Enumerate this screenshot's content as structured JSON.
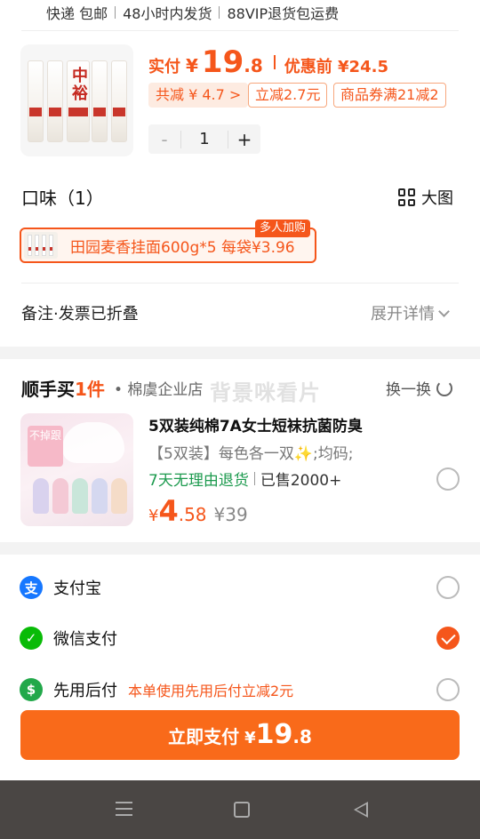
{
  "shipping": {
    "express": "快递 包邮",
    "dispatch": "48小时内发货",
    "vip": "88VIP退货包运费"
  },
  "product": {
    "thumb_brand": "中裕",
    "paid_label": "实付",
    "yen": "¥",
    "price_int": "19",
    "price_dec": ".8",
    "pre_discount": "优惠前 ¥24.5",
    "tags": [
      "共减 ¥ 4.7 >",
      "立减2.7元",
      "商品券满21减2"
    ],
    "stepper": {
      "minus": "-",
      "qty": "1",
      "plus": "+"
    }
  },
  "flavor": {
    "title": "口味（1）",
    "big_pic": "大图",
    "option_label": "田园麦香挂面600g*5  每袋¥3.96",
    "badge": "多人加购"
  },
  "remark": {
    "label": "备注·发票已折叠",
    "expand": "展开详情"
  },
  "shunshou": {
    "title_a": "顺手买",
    "title_b": "1件",
    "shop": "• 棉虞企业店",
    "watermark": "背景咪看片",
    "swap": "换一换",
    "img_label": "不掉跟",
    "name": "5双装纯棉7A女士短袜抗菌防臭",
    "spec": "【5双装】每色各一双✨;均码;",
    "service": "7天无理由退货",
    "sold": "已售2000+",
    "yen": "¥",
    "price_int": "4",
    "price_dec": ".58",
    "orig_price": "¥39",
    "selected": false
  },
  "payment": {
    "methods": [
      {
        "name": "支付宝",
        "icon": "alipay-icon",
        "color": "#1677ff",
        "glyph": "支",
        "selected": false,
        "note": ""
      },
      {
        "name": "微信支付",
        "icon": "wechat-pay-icon",
        "color": "#09bb07",
        "glyph": "✓",
        "selected": true,
        "note": ""
      },
      {
        "name": "先用后付",
        "icon": "pay-later-icon",
        "color": "#22a84a",
        "glyph": "$",
        "selected": false,
        "note": "本单使用先用后付立减2元"
      }
    ],
    "button": {
      "text": "立即支付",
      "yen": "¥",
      "int": "19",
      "dec": ".8"
    }
  },
  "colors": {
    "accent": "#f5561b",
    "pay_button": "#f96a1a",
    "green": "#1c9a4e",
    "navbar": "#4a4644"
  }
}
